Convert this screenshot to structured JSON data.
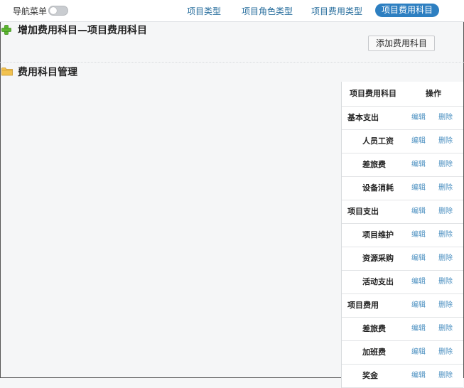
{
  "topbar": {
    "nav_label": "导航菜单",
    "tabs": [
      {
        "label": "项目类型",
        "active": false
      },
      {
        "label": "项目角色类型",
        "active": false
      },
      {
        "label": "项目费用类型",
        "active": false
      },
      {
        "label": "项目费用科目",
        "active": true
      }
    ]
  },
  "form_section": {
    "title": "增加费用科目—项目费用科目",
    "add_button": "添加费用科目"
  },
  "manage_section": {
    "title": "费用科目管理"
  },
  "table": {
    "headers": [
      "项目费用科目",
      "操作"
    ],
    "edit_label": "编辑",
    "delete_label": "删除",
    "rows": [
      {
        "name": "基本支出",
        "level": 0
      },
      {
        "name": "人员工资",
        "level": 1
      },
      {
        "name": "差旅费",
        "level": 1
      },
      {
        "name": "设备消耗",
        "level": 1
      },
      {
        "name": "项目支出",
        "level": 0
      },
      {
        "name": "项目维护",
        "level": 1
      },
      {
        "name": "资源采购",
        "level": 1
      },
      {
        "name": "活动支出",
        "level": 1
      },
      {
        "name": "项目费用",
        "level": 0
      },
      {
        "name": "差旅费",
        "level": 1
      },
      {
        "name": "加班费",
        "level": 1
      },
      {
        "name": "奖金",
        "level": 1
      }
    ]
  },
  "colors": {
    "accent": "#2d7fc1",
    "link": "#4a8fc0",
    "plus_icon": "#5cb531",
    "folder_icon": "#f2c24f"
  }
}
